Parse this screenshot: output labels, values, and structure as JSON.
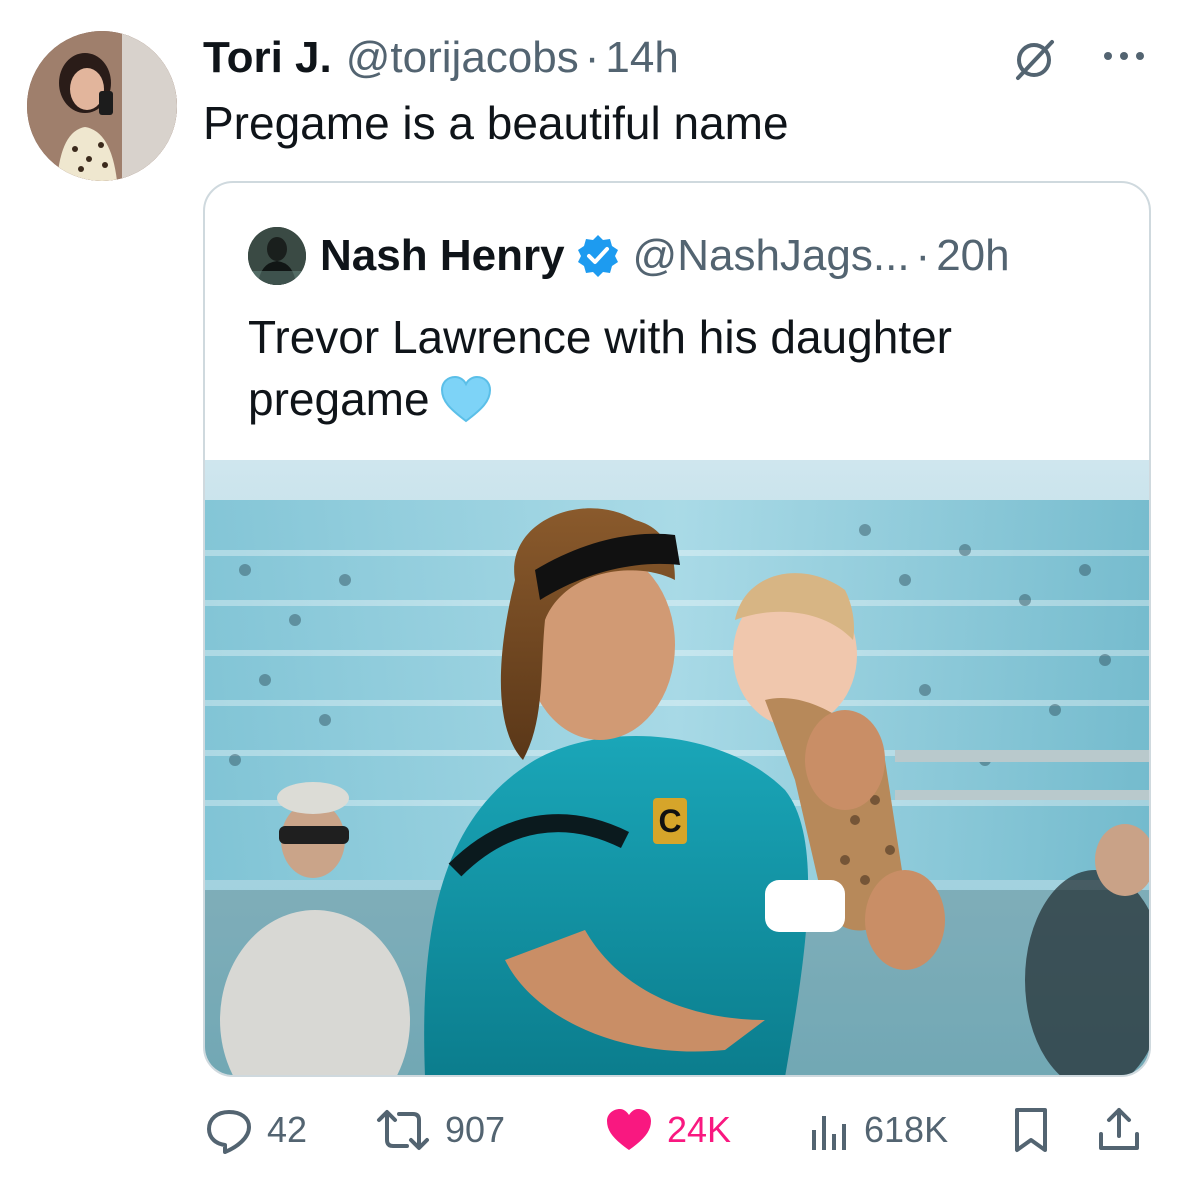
{
  "tweet": {
    "author_name": "Tori J.",
    "author_handle": "@torijacobs",
    "separator": "·",
    "time": "14h",
    "text": "Pregame is a beautiful name"
  },
  "quoted": {
    "author_name": "Nash Henry",
    "author_handle": "@NashJags...",
    "separator": "·",
    "time": "20h",
    "text": "Trevor Lawrence with his daughter pregame",
    "emoji": "light-blue-heart-emoji"
  },
  "actions": {
    "replies": "42",
    "retweets": "907",
    "likes": "24K",
    "views": "618K"
  },
  "colors": {
    "primary_text": "#0f1419",
    "secondary_text": "#536471",
    "like_pink": "#f91880",
    "verified_blue": "#1d9bf0",
    "border": "#cfd9de"
  }
}
